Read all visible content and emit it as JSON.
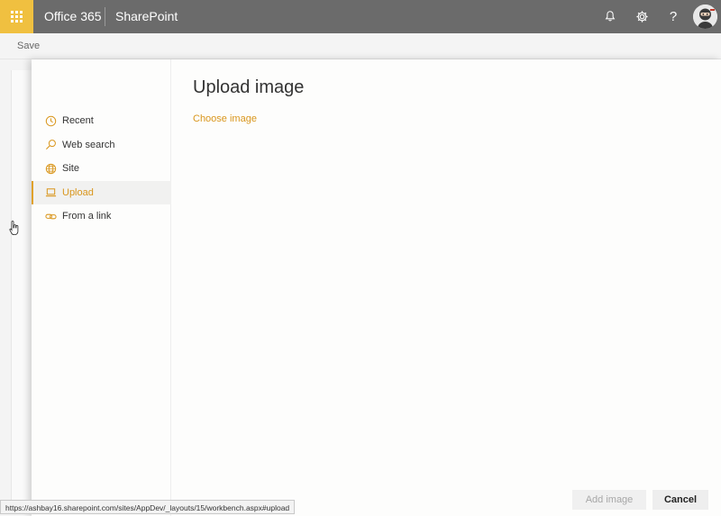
{
  "suite_bar": {
    "brand": "Office 365",
    "app_name": "SharePoint",
    "icons": [
      "app-launcher-icon",
      "bell-icon",
      "gear-icon",
      "help-icon",
      "avatar"
    ],
    "help_glyph": "?",
    "colors": {
      "bar": "#6b6b6b",
      "launcher": "#f0c040"
    }
  },
  "command_bar": {
    "save_label": "Save"
  },
  "panel": {
    "nav": {
      "items": [
        {
          "label": "Recent",
          "icon": "clock-icon",
          "active": false
        },
        {
          "label": "Web search",
          "icon": "search-icon",
          "active": false
        },
        {
          "label": "Site",
          "icon": "globe-icon",
          "active": false
        },
        {
          "label": "Upload",
          "icon": "laptop-icon",
          "active": true
        },
        {
          "label": "From a link",
          "icon": "link-icon",
          "active": false
        }
      ]
    },
    "title": "Upload image",
    "choose_link": "Choose image",
    "add_button": "Add image",
    "cancel_button": "Cancel",
    "accent_color": "#d9961c"
  },
  "status_url": "https://ashbay16.sharepoint.com/sites/AppDev/_layouts/15/workbench.aspx#upload"
}
